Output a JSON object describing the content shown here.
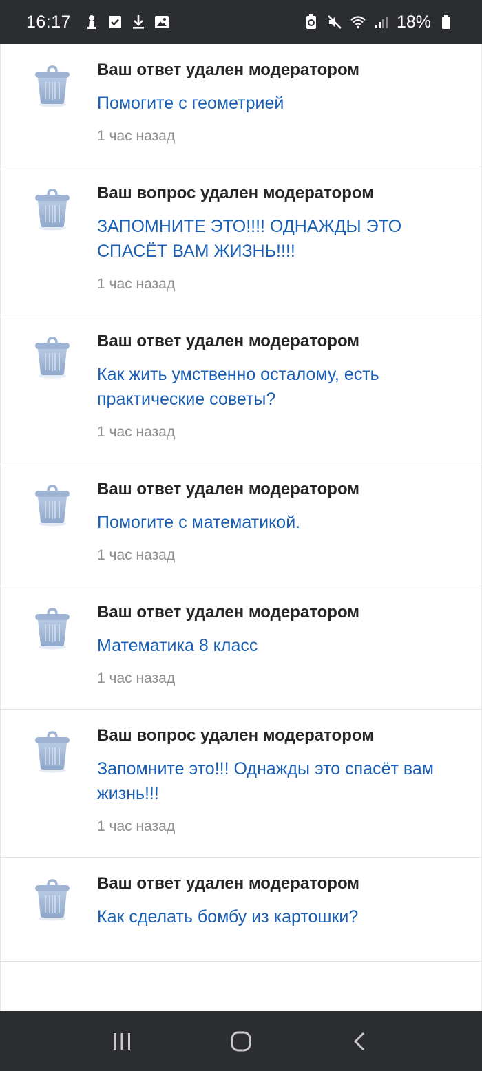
{
  "status_bar": {
    "time": "16:17",
    "battery": "18%",
    "left_icons": [
      "chess-pawn-icon",
      "checkbox-icon",
      "download-icon",
      "image-icon"
    ],
    "right_icons": [
      "recycle-battery-icon",
      "mute-icon",
      "wifi-icon",
      "signal-icon",
      "battery-icon"
    ]
  },
  "notifications": [
    {
      "title": "Ваш ответ удален модератором",
      "link": "Помогите с геометрией",
      "time": "1 час назад"
    },
    {
      "title": "Ваш вопрос удален модератором",
      "link": "ЗАПОМНИТЕ ЭТО!!!! ОДНАЖДЫ ЭТО СПАСЁТ ВАМ ЖИЗНЬ!!!!",
      "time": "1 час назад"
    },
    {
      "title": "Ваш ответ удален модератором",
      "link": "Как жить умственно осталому, есть практические советы?",
      "time": "1 час назад"
    },
    {
      "title": "Ваш ответ удален модератором",
      "link": "Помогите с математикой.",
      "time": "1 час назад"
    },
    {
      "title": "Ваш ответ удален модератором",
      "link": "Математика 8 класс",
      "time": "1 час назад"
    },
    {
      "title": "Ваш вопрос удален модератором",
      "link": "Запомните это!!! Однажды это спасёт вам жизнь!!!",
      "time": "1 час назад"
    },
    {
      "title": "Ваш ответ удален модератором",
      "link": "Как сделать бомбу из картошки?",
      "time": ""
    }
  ],
  "nav_bar": {
    "buttons": [
      "recent-apps-icon",
      "home-icon",
      "back-icon"
    ]
  },
  "colors": {
    "bars": "#2b2d31",
    "title": "#262626",
    "link": "#1a5fb4",
    "time": "#8e8e8e",
    "trash_icon": "#a9bfdc"
  }
}
